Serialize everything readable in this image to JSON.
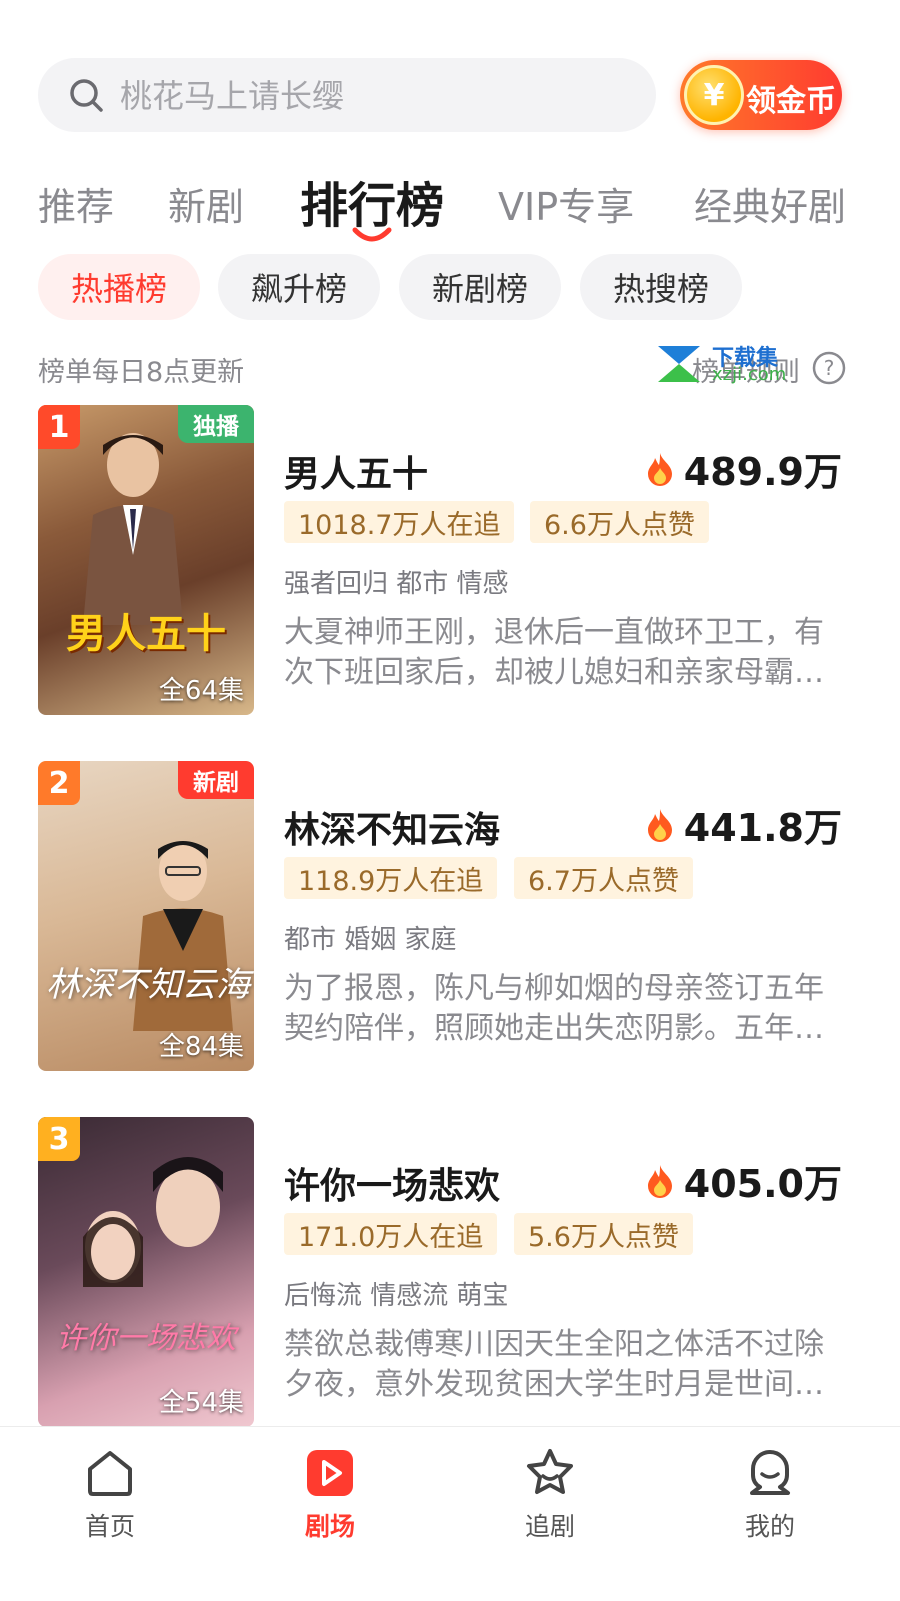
{
  "search": {
    "placeholder": "桃花马上请长缨"
  },
  "coin_button": {
    "label": "领金币",
    "symbol": "¥"
  },
  "tabs": [
    {
      "label": "推荐"
    },
    {
      "label": "新剧"
    },
    {
      "label": "排行榜",
      "active": true
    },
    {
      "label": "VIP专享"
    },
    {
      "label": "经典好剧"
    }
  ],
  "chips": [
    {
      "label": "热播榜",
      "active": true
    },
    {
      "label": "飙升榜"
    },
    {
      "label": "新剧榜"
    },
    {
      "label": "热搜榜"
    }
  ],
  "update_note": "榜单每日8点更新",
  "rules_label": "榜单规则",
  "watermark": {
    "text": "下载集",
    "subtext": "xzji.com"
  },
  "items": [
    {
      "rank": "1",
      "badge": "独播",
      "poster_title": "男人五十",
      "episodes": "全64集",
      "title": "男人五十",
      "hot": "489.9万",
      "followers": "1018.7万人在追",
      "likes": "6.6万人点赞",
      "genres": "强者回归 都市 情感",
      "description": "大夏神师王刚，退休后一直做环卫工，有次下班回家后，却被儿媳妇和亲家母霸…"
    },
    {
      "rank": "2",
      "badge": "新剧",
      "poster_title": "林深不知云海",
      "episodes": "全84集",
      "title": "林深不知云海",
      "hot": "441.8万",
      "followers": "118.9万人在追",
      "likes": "6.7万人点赞",
      "genres": "都市 婚姻 家庭",
      "description": "为了报恩，陈凡与柳如烟的母亲签订五年契约陪伴，照顾她走出失恋阴影。五年…"
    },
    {
      "rank": "3",
      "badge": "",
      "poster_title": "许你一场悲欢",
      "episodes": "全54集",
      "title": "许你一场悲欢",
      "hot": "405.0万",
      "followers": "171.0万人在追",
      "likes": "5.6万人点赞",
      "genres": "后悔流 情感流 萌宝",
      "description": "禁欲总裁傅寒川因天生全阳之体活不过除夕夜，意外发现贫困大学生时月是世间…"
    }
  ],
  "bottom_nav": [
    {
      "label": "首页",
      "icon": "home-icon"
    },
    {
      "label": "剧场",
      "icon": "theater-play-icon",
      "active": true
    },
    {
      "label": "追剧",
      "icon": "follow-star-icon"
    },
    {
      "label": "我的",
      "icon": "profile-icon"
    }
  ],
  "colors": {
    "accent": "#ff3b2f",
    "rank1": "#ff4a2a",
    "rank2": "#ff7a2a",
    "rank3": "#ffb020",
    "stat_bg": "#fff3df",
    "stat_text": "#9a6a2a"
  }
}
